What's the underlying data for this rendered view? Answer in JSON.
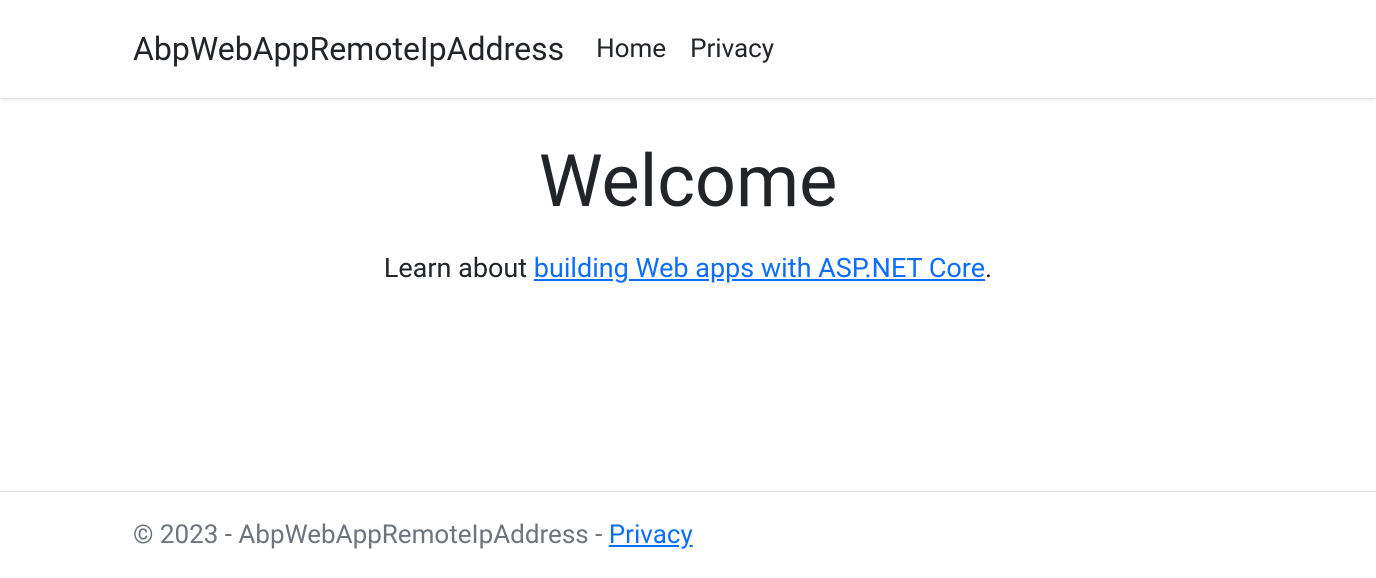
{
  "navbar": {
    "brand": "AbpWebAppRemoteIpAddress",
    "links": {
      "home": "Home",
      "privacy": "Privacy"
    }
  },
  "main": {
    "title": "Welcome",
    "lead_pre": "Learn about ",
    "lead_link": "building Web apps with ASP.NET Core",
    "lead_post": "."
  },
  "footer": {
    "text": "© 2023 - AbpWebAppRemoteIpAddress - ",
    "privacy_link": "Privacy"
  }
}
